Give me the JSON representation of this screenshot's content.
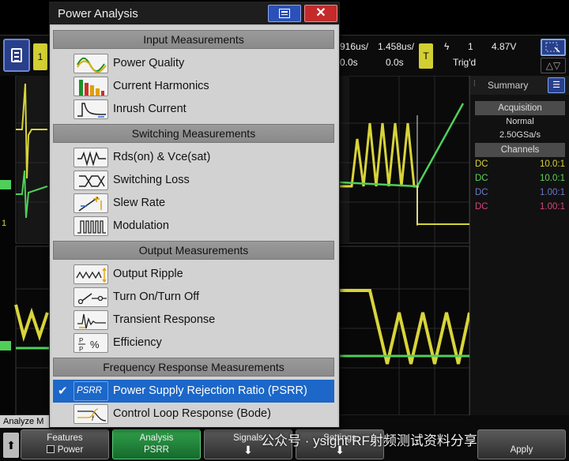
{
  "topbar": {
    "ch1_label": "1",
    "timebase_1": "916us/",
    "timebase_1_offset": "0.0s",
    "timebase_2": "1.458us/",
    "timebase_2_offset": "0.0s",
    "trigger_channel": "1",
    "trigger_level": "4.87V",
    "trigger_status": "Trig'd",
    "trigger_source_btn": "T",
    "measure_tool_glyph": "△▽"
  },
  "side_panel": {
    "title": "Summary",
    "acquisition_header": "Acquisition",
    "acquisition_mode": "Normal",
    "sample_rate": "2.50GSa/s",
    "channels_header": "Channels",
    "channels": [
      {
        "coupling": "DC",
        "probe": "10.0:1",
        "color": "#d8d43a"
      },
      {
        "coupling": "DC",
        "probe": "10.0:1",
        "color": "#5fd35a"
      },
      {
        "coupling": "DC",
        "probe": "1.00:1",
        "color": "#6d79c7"
      },
      {
        "coupling": "DC",
        "probe": "1.00:1",
        "color": "#d4457a"
      }
    ]
  },
  "dialog": {
    "title": "Power Analysis",
    "sections": [
      {
        "header": "Input Measurements",
        "items": [
          {
            "label": "Power Quality",
            "icon": "power-quality-icon"
          },
          {
            "label": "Current Harmonics",
            "icon": "current-harmonics-icon"
          },
          {
            "label": "Inrush Current",
            "icon": "inrush-current-icon"
          }
        ]
      },
      {
        "header": "Switching Measurements",
        "items": [
          {
            "label": "Rds(on) & Vce(sat)",
            "icon": "rds-on-icon"
          },
          {
            "label": "Switching Loss",
            "icon": "switching-loss-icon"
          },
          {
            "label": "Slew Rate",
            "icon": "slew-rate-icon"
          },
          {
            "label": "Modulation",
            "icon": "modulation-icon"
          }
        ]
      },
      {
        "header": "Output Measurements",
        "items": [
          {
            "label": "Output Ripple",
            "icon": "output-ripple-icon"
          },
          {
            "label": "Turn On/Turn Off",
            "icon": "turn-on-off-icon"
          },
          {
            "label": "Transient Response",
            "icon": "transient-response-icon"
          },
          {
            "label": "Efficiency",
            "icon": "efficiency-icon"
          }
        ]
      },
      {
        "header": "Frequency Response Measurements",
        "items": [
          {
            "label": "Power Supply Rejection Ratio (PSRR)",
            "icon": "psrr-icon",
            "icon_text": "PSRR",
            "selected": true
          },
          {
            "label": "Control Loop Response (Bode)",
            "icon": "bode-icon"
          }
        ]
      }
    ],
    "efficiency_icon_text": "%"
  },
  "bottom": {
    "analyze_tab": "Analyze M",
    "up_arrow": "⬆",
    "softkeys": [
      {
        "line1": "Features",
        "line2": "Power",
        "has_checkbox": true
      },
      {
        "line1": "Analysis",
        "line2": "PSRR",
        "active": true
      },
      {
        "line1": "Signals",
        "line2": ""
      },
      {
        "line1": "Settings",
        "line2": ""
      },
      {
        "line1": "Apply",
        "line2": ""
      }
    ],
    "watermark": "公众号 · ysight RF射频测试资料分享"
  },
  "colors": {
    "ch1": "#d8d43a",
    "ch2": "#4fcf5a",
    "accent_blue": "#1c67c8",
    "close_red": "#c42a2a"
  }
}
